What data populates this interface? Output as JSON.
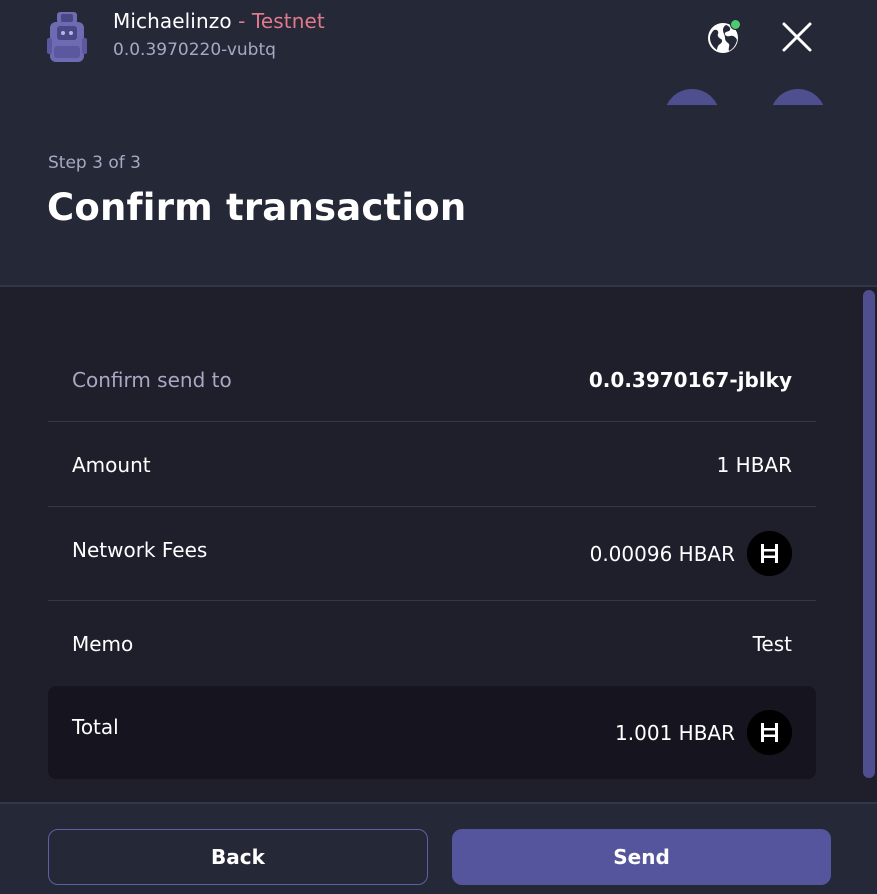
{
  "header": {
    "account_name": "Michaelinzo",
    "network_label": " - Testnet",
    "account_id": "0.0.3970220-vubtq",
    "step_label": "Step 3 of 3",
    "title": "Confirm transaction",
    "icons": [
      "backpack-wallet-icon",
      "globe-icon",
      "close-icon"
    ],
    "status_color": "#4ecb71"
  },
  "details": {
    "confirm_send_to": {
      "label": "Confirm send to",
      "value": "0.0.3970167-jblky"
    },
    "amount": {
      "label": "Amount",
      "value": "1 HBAR"
    },
    "network_fees": {
      "label": "Network Fees",
      "value": "0.00096 HBAR",
      "icon": "hbar-icon"
    },
    "memo": {
      "label": "Memo",
      "value": "Test"
    },
    "total": {
      "label": "Total",
      "value": "1.001 HBAR",
      "icon": "hbar-icon"
    }
  },
  "footer": {
    "back_label": "Back",
    "send_label": "Send"
  },
  "colors": {
    "accent": "#55559d",
    "network": "#e07a8a",
    "background": "#252836"
  }
}
